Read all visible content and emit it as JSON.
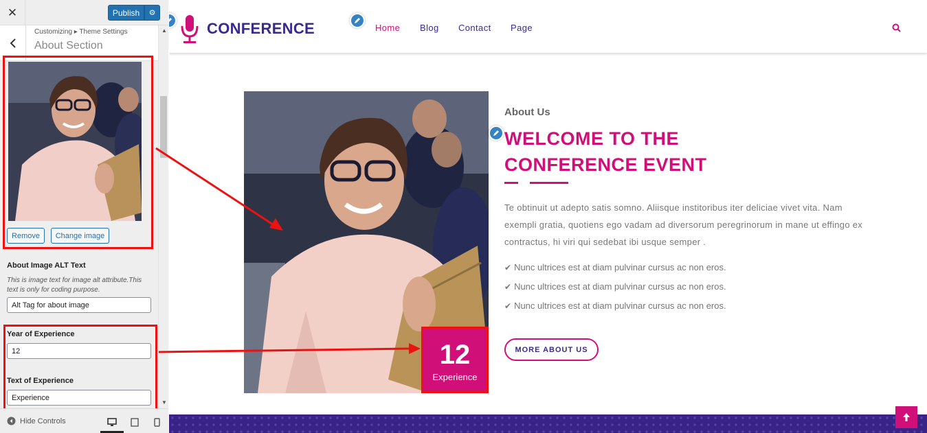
{
  "panel": {
    "close_icon": "close-icon",
    "publish_label": "Publish",
    "breadcrumb": "Customizing ▸ Theme Settings",
    "section_title": "About Section",
    "remove_label": "Remove",
    "change_image_label": "Change image",
    "alt_label": "About Image ALT Text",
    "alt_description": "This is image text for image alt attribute.This text is only for coding purpose.",
    "alt_value": "Alt Tag for about image",
    "year_label": "Year of Experience",
    "year_value": "12",
    "exp_text_label": "Text of Experience",
    "exp_text_value": "Experience",
    "hide_controls": "Hide Controls"
  },
  "site": {
    "logo": "CONFERENCE",
    "nav": [
      "Home",
      "Blog",
      "Contact",
      "Page"
    ],
    "about_subtitle": "About Us",
    "headline_1": "WELCOME TO THE",
    "headline_2": "CONFERENCE EVENT",
    "paragraph": "Te obtinuit ut adepto satis somno. Aliisque institoribus iter deliciae vivet vita. Nam exempli gratia, quotiens ego vadam ad diversorum peregrinorum in mane ut effingo ex contractus, hi viri qui sedebat ibi usque semper .",
    "checks": [
      "Nunc ultrices est at diam pulvinar cursus ac non eros.",
      "Nunc ultrices est at diam pulvinar cursus ac non eros.",
      "Nunc ultrices est at diam pulvinar cursus ac non eros."
    ],
    "year_number": "12",
    "year_text": "Experience",
    "more_button": "MORE ABOUT US"
  },
  "colors": {
    "accent": "#d10f78",
    "brand": "#3a2a8c",
    "wp_blue": "#2271b1",
    "annotation_red": "#ee1111"
  }
}
